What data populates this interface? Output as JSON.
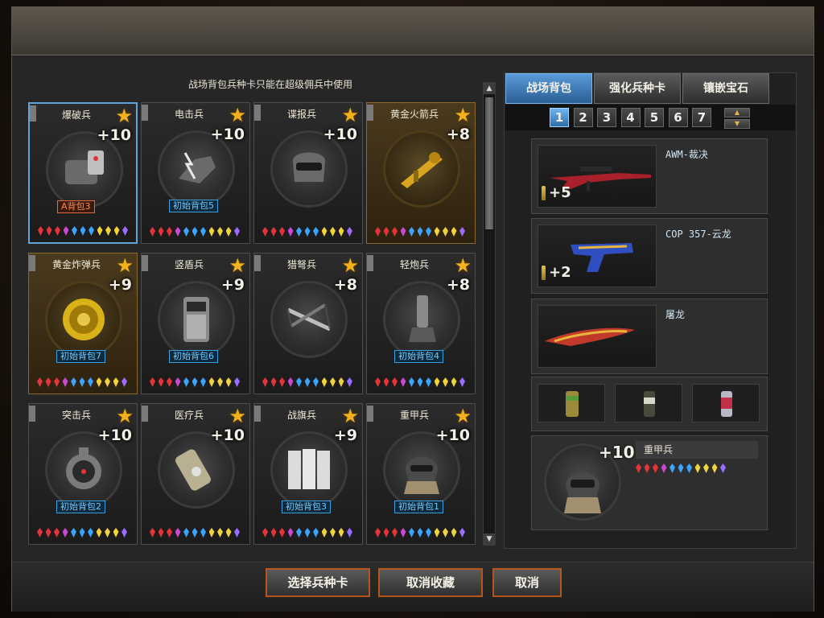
{
  "notice": "战场背包兵种卡只能在超级佣兵中使用",
  "cards": [
    {
      "name": "爆破兵",
      "plus": "+10",
      "badge": "A背包3",
      "badge_style": "red",
      "gold": false,
      "selected": true,
      "icon": "explosive-pack-icon",
      "col": 0,
      "row": 0
    },
    {
      "name": "电击兵",
      "plus": "+10",
      "badge": "初始背包5",
      "badge_style": "blue",
      "gold": false,
      "selected": false,
      "icon": "electric-fist-icon",
      "col": 1,
      "row": 0
    },
    {
      "name": "谍报兵",
      "plus": "+10",
      "badge": "",
      "badge_style": "blue",
      "gold": false,
      "selected": false,
      "icon": "spy-mask-icon",
      "col": 2,
      "row": 0
    },
    {
      "name": "黄金火箭兵",
      "plus": "+8",
      "badge": "",
      "badge_style": "blue",
      "gold": true,
      "selected": false,
      "icon": "golden-rocket-launcher-icon",
      "col": 3,
      "row": 0
    },
    {
      "name": "黄金炸弹兵",
      "plus": "+9",
      "badge": "初始背包7",
      "badge_style": "blue",
      "gold": true,
      "selected": false,
      "icon": "golden-bomb-icon",
      "col": 0,
      "row": 1
    },
    {
      "name": "竖盾兵",
      "plus": "+9",
      "badge": "初始背包6",
      "badge_style": "blue",
      "gold": false,
      "selected": false,
      "icon": "riot-shield-icon",
      "col": 1,
      "row": 1
    },
    {
      "name": "猎弩兵",
      "plus": "+8",
      "badge": "",
      "badge_style": "blue",
      "gold": false,
      "selected": false,
      "icon": "crossbow-icon",
      "col": 2,
      "row": 1
    },
    {
      "name": "轻炮兵",
      "plus": "+8",
      "badge": "初始背包4",
      "badge_style": "blue",
      "gold": false,
      "selected": false,
      "icon": "mortar-icon",
      "col": 3,
      "row": 1
    },
    {
      "name": "突击兵",
      "plus": "+10",
      "badge": "初始背包2",
      "badge_style": "blue",
      "gold": false,
      "selected": false,
      "icon": "assault-device-icon",
      "col": 0,
      "row": 2
    },
    {
      "name": "医疗兵",
      "plus": "+10",
      "badge": "",
      "badge_style": "blue",
      "gold": false,
      "selected": false,
      "icon": "medkit-canister-icon",
      "col": 1,
      "row": 2
    },
    {
      "name": "战旗兵",
      "plus": "+9",
      "badge": "初始背包3",
      "badge_style": "blue",
      "gold": false,
      "selected": false,
      "icon": "war-banner-icon",
      "col": 2,
      "row": 2
    },
    {
      "name": "重甲兵",
      "plus": "+10",
      "badge": "初始背包1",
      "badge_style": "blue",
      "gold": false,
      "selected": false,
      "icon": "heavy-armor-helmet-icon",
      "col": 3,
      "row": 2
    }
  ],
  "gem_colors": [
    "#e4343a",
    "#e4343a",
    "#e4343a",
    "#c94ad1",
    "#3aa4ff",
    "#3aa4ff",
    "#3aa4ff",
    "#f0d23a",
    "#f0d23a",
    "#f0d23a",
    "#9a6cff"
  ],
  "right_tabs": [
    "战场背包",
    "强化兵种卡",
    "镶嵌宝石"
  ],
  "pages": [
    "1",
    "2",
    "3",
    "4",
    "5",
    "6",
    "7"
  ],
  "active_page": "1",
  "weapons": [
    {
      "name": "AWM-裁决",
      "ammo": "+5",
      "icon": "sniper-rifle-icon"
    },
    {
      "name": "COP 357-云龙",
      "ammo": "+2",
      "icon": "pistol-icon"
    },
    {
      "name": "屠龙",
      "ammo": "",
      "icon": "knife-icon"
    }
  ],
  "gadgets": [
    "grenade-can-icon",
    "flash-grenade-icon",
    "smoke-grenade-icon"
  ],
  "soldier": {
    "name": "重甲兵",
    "plus": "+10",
    "icon": "heavy-armor-helmet-icon"
  },
  "buttons": {
    "select": "选择兵种卡",
    "unfavorite": "取消收藏",
    "cancel": "取消"
  }
}
